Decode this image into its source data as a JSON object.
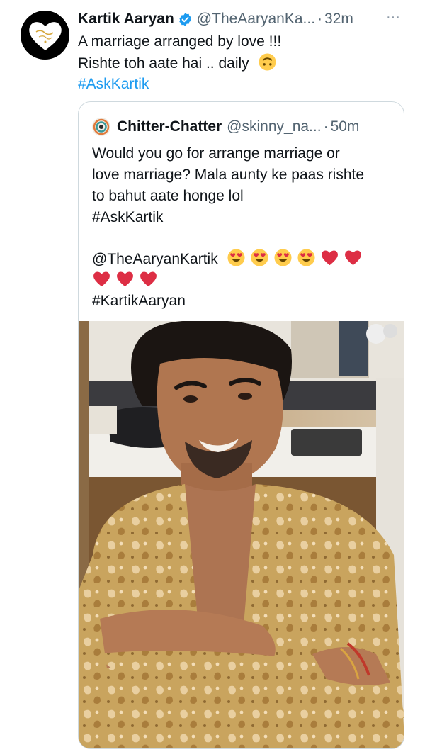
{
  "tweet": {
    "author_name": "Kartik Aaryan",
    "author_handle": "@TheAaryanKa...",
    "dot": "·",
    "time": "32m",
    "more": "···",
    "line1": "A marriage arranged by love !!!",
    "line2": "Rishte toh aate hai .. daily",
    "hashtag": "#AskKartik",
    "icons": {
      "verified": "verified-badge-icon",
      "more": "more-options-icon",
      "emoji": "upside-down-face-emoji"
    },
    "colors": {
      "link": "#1d9bf0",
      "verified": "#1d9bf0",
      "muted": "#536471"
    }
  },
  "quote": {
    "author_name": "Chitter-Chatter",
    "author_handle": "@skinny_na...",
    "dot": "·",
    "time": "50m",
    "lines": [
      "Would you go for arrange marriage or",
      "love marriage? Mala aunty ke paas rishte",
      "to bahut aate honge lol",
      "#AskKartik"
    ],
    "mention": "@TheAaryanKartik",
    "final_hashtag": "#KartikAaryan",
    "icons": {
      "emoji_row": [
        "heart-eyes-emoji",
        "heart-eyes-emoji",
        "heart-eyes-emoji",
        "heart-eyes-emoji",
        "red-heart-emoji",
        "red-heart-emoji"
      ],
      "emoji_row2": [
        "red-heart-emoji",
        "red-heart-emoji",
        "red-heart-emoji"
      ]
    }
  }
}
